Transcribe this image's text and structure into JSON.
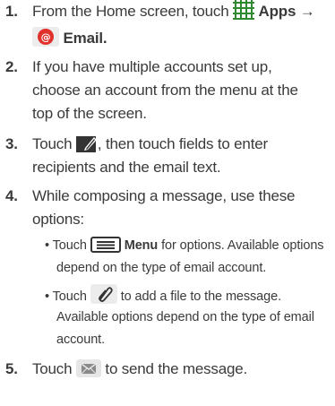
{
  "steps": [
    {
      "number": "1.",
      "line1_prefix": "From the Home screen, touch",
      "apps_label": "Apps",
      "arrow": "→",
      "email_label": "Email",
      "line1_suffix": "."
    },
    {
      "number": "2.",
      "lines": [
        "If you have multiple accounts set up,",
        "choose an account from the menu at the",
        "top of the screen."
      ]
    },
    {
      "number": "3.",
      "prefix": "Touch",
      "suffix": ", then touch fields to enter",
      "line2": "recipients and the email text."
    },
    {
      "number": "4.",
      "lines": [
        "While composing a message, use these",
        "options:"
      ],
      "bullets": [
        {
          "bullet_char": "•",
          "prefix": "Touch",
          "menu_label": "Menu",
          "suffix": " for options. Available options",
          "line2": "depend on the type of email account."
        },
        {
          "bullet_char": "•",
          "prefix": "Touch",
          "suffix": " to add a file to the message.",
          "line2": "Available options depend on the type of email",
          "line3": "account."
        }
      ]
    },
    {
      "number": "5.",
      "prefix": "Touch",
      "suffix": " to send the message."
    }
  ],
  "icons": {
    "apps": "apps-grid-icon",
    "email": "email-app-icon",
    "compose": "compose-icon",
    "menu": "menu-icon",
    "attach": "attach-icon",
    "send": "send-icon"
  },
  "colors": {
    "text": "#3a3a3a",
    "apps_icon": "#2f8a2f",
    "email_icon": "#e0312c",
    "icon_dark": "#333333"
  }
}
